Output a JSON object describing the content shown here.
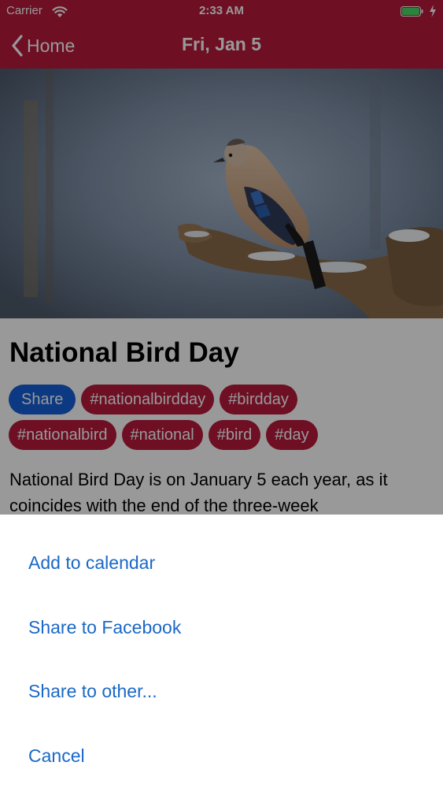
{
  "status_bar": {
    "carrier": "Carrier",
    "time": "2:33 AM",
    "wifi_icon": "wifi-icon",
    "battery_icon": "battery-icon",
    "charge_icon": "bolt-icon"
  },
  "nav": {
    "back_label": "Home",
    "back_icon": "chevron-left-icon",
    "title": "Fri, Jan 5",
    "color": "#b8193c"
  },
  "event": {
    "title": "National Bird Day",
    "share_label": "Share",
    "tags_row1": [
      "#nationalbirdday",
      "#birdday"
    ],
    "tags_row2": [
      "#nationalbird",
      "#national",
      "#bird",
      "#day"
    ],
    "description": "National Bird Day is on January 5 each year, as it coincides with the end of the three-week"
  },
  "action_sheet": {
    "items": [
      "Add to calendar",
      "Share to Facebook",
      "Share to other...",
      "Cancel"
    ]
  },
  "colors": {
    "accent": "#b8193c",
    "share": "#1560d8",
    "link": "#1a68c7"
  }
}
